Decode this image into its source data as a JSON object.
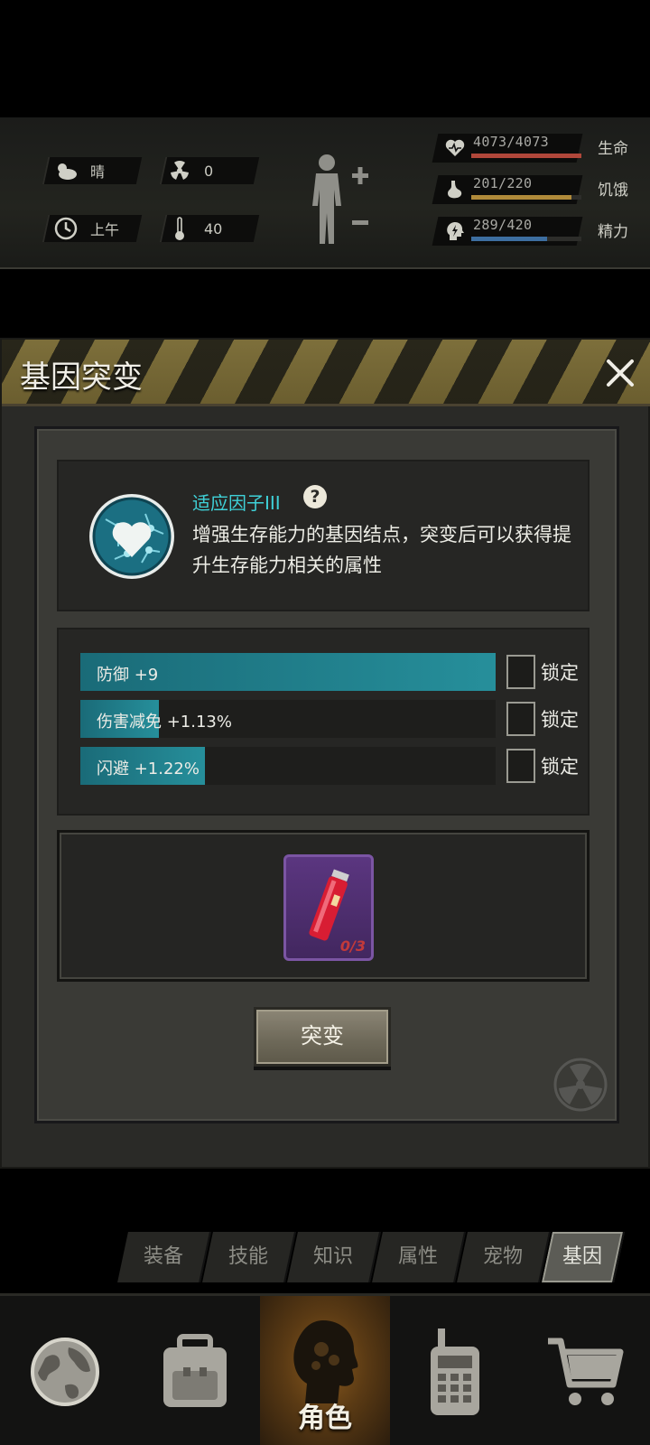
{
  "hud": {
    "weather": "晴",
    "radiation": "0",
    "time": "上午",
    "temperature": "40",
    "stats": [
      {
        "value": "4073/4073",
        "name": "生命",
        "ratio": 1.0,
        "color": "#b0473a"
      },
      {
        "value": "201/220",
        "name": "饥饿",
        "ratio": 0.91,
        "color": "#b08a3a"
      },
      {
        "value": "289/420",
        "name": "精力",
        "ratio": 0.69,
        "color": "#3d6ea0"
      }
    ]
  },
  "modal": {
    "title": "基因突变",
    "gene": {
      "name": "适应因子III",
      "help": "?",
      "description": "增强生存能力的基因结点，突变后可以获得提升生存能力相关的属性"
    },
    "attributes": [
      {
        "label": "防御 +9",
        "fill": 1.0,
        "lock": "锁定"
      },
      {
        "label": "伤害减免 +1.13%",
        "fill": 0.19,
        "lock": "锁定"
      },
      {
        "label": "闪避 +1.22%",
        "fill": 0.3,
        "lock": "锁定"
      }
    ],
    "cost_item": {
      "icon": "red-vial-icon",
      "count": "0/3"
    },
    "mutate_label": "突变"
  },
  "subtabs": [
    "装备",
    "技能",
    "知识",
    "属性",
    "宠物",
    "基因"
  ],
  "active_subtab": "基因",
  "bottom_nav": {
    "items": [
      "globe-icon",
      "backpack-icon",
      "character-icon",
      "radio-icon",
      "cart-icon"
    ],
    "active_label": "角色"
  }
}
